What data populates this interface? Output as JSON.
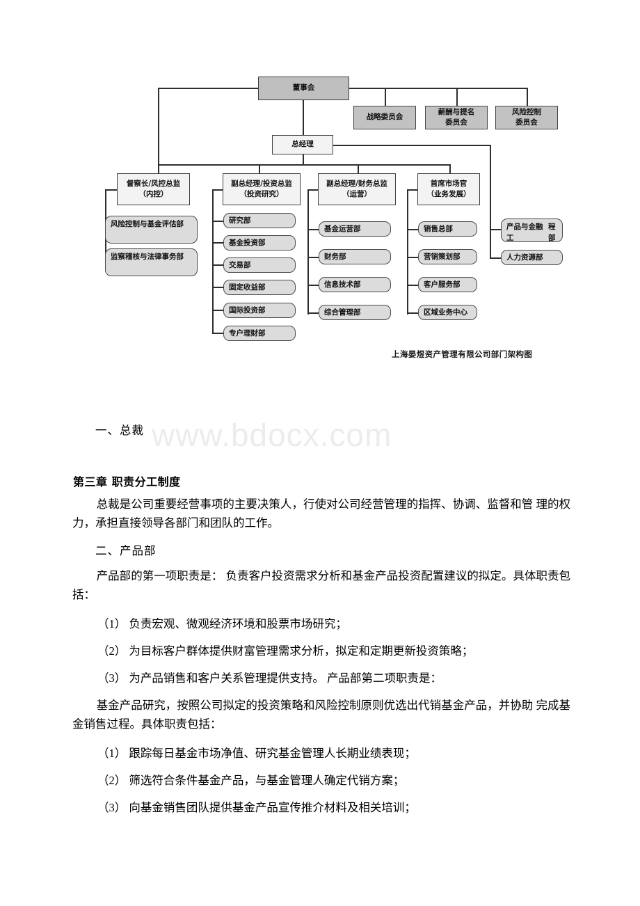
{
  "watermark": {
    "text": "www.bdocx.com"
  },
  "org_chart": {
    "caption": "上海晏煜资产管理有限公司部门架构图",
    "board": {
      "label": "董事会"
    },
    "general_manager": {
      "label": "总经理"
    },
    "committees": [
      {
        "label": "战略委员会",
        "line1": "战略委员会",
        "line2": ""
      },
      {
        "label": "薪酬与提名委员会",
        "line1": "薪酬与提名",
        "line2": "委员会"
      },
      {
        "label": "风险控制委员会",
        "line1": "风险控制",
        "line2": "委员会"
      }
    ],
    "managers": [
      {
        "line1": "督察长/风控总监",
        "line2": "（内控）"
      },
      {
        "line1": "副总经理/投资总监",
        "line2": "（投资研究）"
      },
      {
        "line1": "副总经理/财务总监",
        "line2": "（运营）"
      },
      {
        "line1": "首席市场官",
        "line2": "（业务发展）"
      }
    ],
    "columns": [
      {
        "parent": "督察长/风控总监（内控）",
        "departments": [
          {
            "line1": "风险控制与基金评估",
            "line2": "部"
          },
          {
            "line1": "监察稽核与法律事务",
            "line2": "部"
          }
        ]
      },
      {
        "parent": "副总经理/投资总监（投资研究）",
        "departments": [
          {
            "line1": "研究部",
            "line2": ""
          },
          {
            "line1": "基金投资部",
            "line2": ""
          },
          {
            "line1": "交易部",
            "line2": ""
          },
          {
            "line1": "固定收益部",
            "line2": ""
          },
          {
            "line1": "国际投资部",
            "line2": ""
          },
          {
            "line1": "专户理财部",
            "line2": ""
          }
        ]
      },
      {
        "parent": "副总经理/财务总监（运营）",
        "departments": [
          {
            "line1": "基金运营部",
            "line2": ""
          },
          {
            "line1": "财务部",
            "line2": ""
          },
          {
            "line1": "信息技术部",
            "line2": ""
          },
          {
            "line1": "综合管理部",
            "line2": ""
          }
        ]
      },
      {
        "parent": "首席市场官（业务发展）",
        "departments": [
          {
            "line1": "销售总部",
            "line2": ""
          },
          {
            "line1": "营销策划部",
            "line2": ""
          },
          {
            "line1": "客户服务部",
            "line2": ""
          },
          {
            "line1": "区域业务中心",
            "line2": ""
          }
        ]
      },
      {
        "parent": "总经理",
        "departments": [
          {
            "line1": "产品与金融工",
            "line2": "程部"
          },
          {
            "line1": "人力资源部",
            "line2": ""
          }
        ]
      }
    ]
  },
  "document": {
    "section_one_heading": "一、总裁",
    "chapter_heading": "第三章 职责分工制度",
    "president_paragraph": "总裁是公司重要经营事项的主要决策人，行使对公司经营管理的指挥、协调、监督和管 理的权力，承担直接领导各部门和团队的工作。",
    "section_two_heading": "二、产品部",
    "product_para_1": "产品部的第一项职责是： 负责客户投资需求分析和基金产品投资配置建议的拟定。具体职责包括：",
    "product_list_1": [
      "（1） 负责宏观、微观经济环境和股票市场研究；",
      "（2） 为目标客户群体提供财富管理需求分析，拟定和定期更新投资策略；",
      "（3） 为产品销售和客户关系管理提供支持。 产品部第二项职责是："
    ],
    "product_para_2": "基金产品研究，按照公司拟定的投资策略和风险控制原则优选出代销基金产品，并协助 完成基金销售过程。具体职责包括：",
    "product_list_2": [
      "（1） 跟踪每日基金市场净值、研究基金管理人长期业绩表现；",
      "（2） 筛选符合条件基金产品，与基金管理人确定代销方案；",
      "（3） 向基金销售团队提供基金产品宣传推介材料及相关培训；"
    ]
  }
}
